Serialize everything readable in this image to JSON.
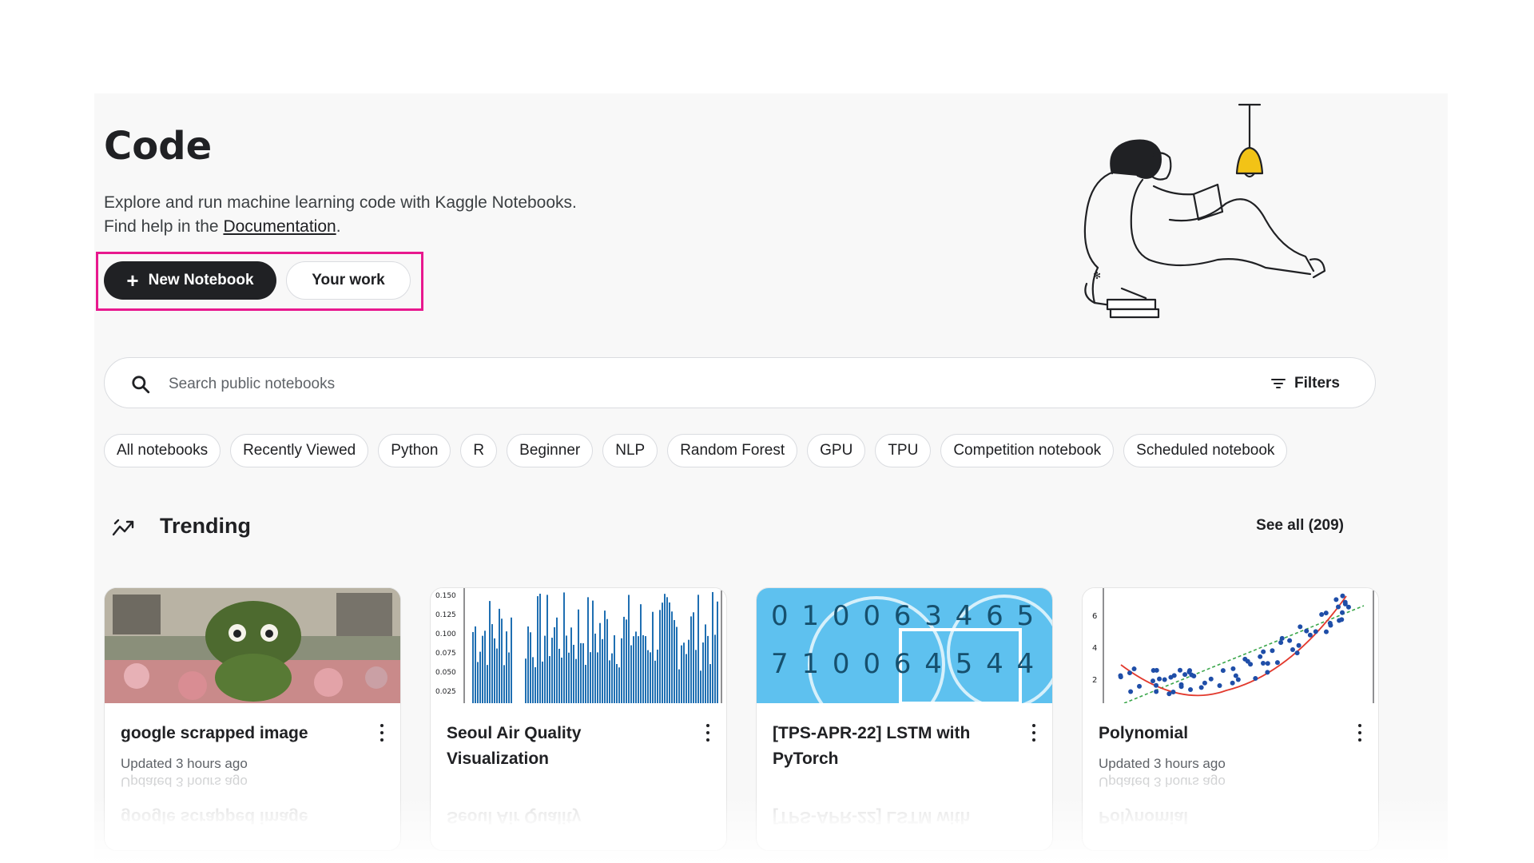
{
  "header": {
    "title": "Code",
    "subtitle_line1": "Explore and run machine learning code with Kaggle Notebooks.",
    "subtitle_line2_prefix": "Find help in the ",
    "documentation_link": "Documentation",
    "subtitle_line2_suffix": "."
  },
  "actions": {
    "new_notebook_label": "New Notebook",
    "your_work_label": "Your work",
    "highlight_color": "#e8188e"
  },
  "search": {
    "placeholder": "Search public notebooks",
    "filters_label": "Filters"
  },
  "chips": [
    {
      "label": "All notebooks"
    },
    {
      "label": "Recently Viewed"
    },
    {
      "label": "Python"
    },
    {
      "label": "R"
    },
    {
      "label": "Beginner"
    },
    {
      "label": "NLP"
    },
    {
      "label": "Random Forest"
    },
    {
      "label": "GPU"
    },
    {
      "label": "TPU"
    },
    {
      "label": "Competition notebook"
    },
    {
      "label": "Scheduled notebook"
    }
  ],
  "trending": {
    "title": "Trending",
    "see_all": "See all (209)",
    "cards": [
      {
        "title": "google scrapped image",
        "meta": "Updated 3 hours ago",
        "thumb": "garden-topiary-photo",
        "reflection_title": "google scrapped image"
      },
      {
        "title": "Seoul Air Quality Visualization",
        "meta": "",
        "thumb": "blue-spike-chart",
        "axis_ticks": [
          "0.150",
          "0.125",
          "0.100",
          "0.075",
          "0.050",
          "0.025"
        ],
        "reflection_title": "Seoul Air Quality"
      },
      {
        "title": "[TPS-APR-22] LSTM with PyTorch",
        "meta": "",
        "thumb": "digit-grid-image",
        "digits_row1": "0 1 0 0 6 3 4 6 5",
        "digits_row2": "7 1 0 0 6 4 5 4 4",
        "reflection_title": "[TPS-APR-22] LSTM with"
      },
      {
        "title": "Polynomial",
        "meta": "Updated 3 hours ago",
        "thumb": "scatter-polynomial-fit",
        "axis_ticks": [
          "6",
          "4",
          "2"
        ],
        "reflection_title": "Polynomial"
      }
    ]
  },
  "colors": {
    "primary_button": "#202124",
    "page_background": "#f8f8f8",
    "chart_blue": "#1f6fb2",
    "digit_tile": "#5ec1ef"
  }
}
